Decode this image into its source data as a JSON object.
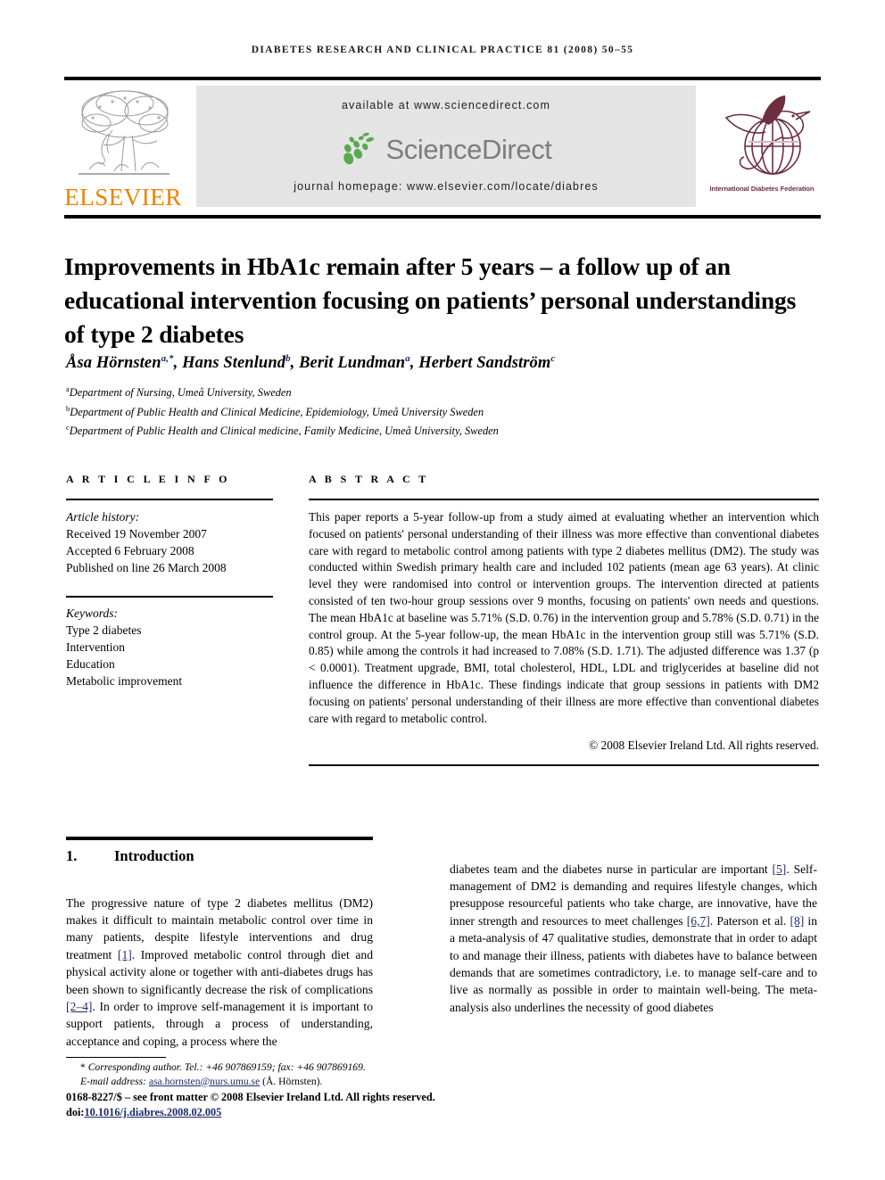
{
  "running_head": "DIABETES RESEARCH AND CLINICAL PRACTICE 81 (2008) 50–55",
  "header": {
    "elsevier_wordmark": "ELSEVIER",
    "elsevier_tree_icon": "elsevier-tree-icon",
    "available_at": "available at www.sciencedirect.com",
    "sciencedirect_wordmark": "ScienceDirect",
    "sciencedirect_leaf_icon": "sciencedirect-leaf-icon",
    "journal_homepage": "journal homepage: www.elsevier.com/locate/diabres",
    "idf_caption": "International Diabetes Federation",
    "idf_bird_globe_icon": "idf-bird-globe-icon",
    "colors": {
      "elsevier_orange": "#F08000",
      "sciencedirect_green": "#5aa84f",
      "sciencedirect_grey": "#7d7d7d",
      "band_grey": "#e4e4e4",
      "idf_maroon": "#6d2f3f"
    }
  },
  "article": {
    "title": "Improvements in HbA1c remain after 5 years – a follow up of an educational intervention focusing on patients’ personal understandings of type 2 diabetes",
    "authors_html": "Åsa Hörnsten<sup>a,*</sup>, Hans Stenlund<sup>b</sup>, Berit Lundman<sup>a</sup>, Herbert Sandström<sup>c</sup>",
    "affiliations": [
      {
        "marker": "a",
        "text": "Department of Nursing, Umeå University, Sweden"
      },
      {
        "marker": "b",
        "text": "Department of Public Health and Clinical Medicine, Epidemiology, Umeå University Sweden"
      },
      {
        "marker": "c",
        "text": "Department of Public Health and Clinical medicine, Family Medicine, Umeå University, Sweden"
      }
    ]
  },
  "article_info": {
    "heading": "A R T I C L E   I N F O",
    "history_label": "Article history:",
    "history": [
      "Received 19 November 2007",
      "Accepted 6 February 2008",
      "Published on line 26 March 2008"
    ],
    "keywords_label": "Keywords:",
    "keywords": [
      "Type 2 diabetes",
      "Intervention",
      "Education",
      "Metabolic improvement"
    ]
  },
  "abstract": {
    "heading": "A B S T R A C T",
    "text": "This paper reports a 5-year follow-up from a study aimed at evaluating whether an intervention which focused on patients' personal understanding of their illness was more effective than conventional diabetes care with regard to metabolic control among patients with type 2 diabetes mellitus (DM2). The study was conducted within Swedish primary health care and included 102 patients (mean age 63 years). At clinic level they were randomised into control or intervention groups. The intervention directed at patients consisted of ten two-hour group sessions over 9 months, focusing on patients' own needs and questions. The mean HbA1c at baseline was 5.71% (S.D. 0.76) in the intervention group and 5.78% (S.D. 0.71) in the control group. At the 5-year follow-up, the mean HbA1c in the intervention group still was 5.71% (S.D. 0.85) while among the controls it had increased to 7.08% (S.D. 1.71). The adjusted difference was 1.37 (p < 0.0001). Treatment upgrade, BMI, total cholesterol, HDL, LDL and triglycerides at baseline did not influence the difference in HbA1c. These findings indicate that group sessions in patients with DM2 focusing on patients' personal understanding of their illness are more effective than conventional diabetes care with regard to metabolic control.",
    "copyright": "© 2008 Elsevier Ireland Ltd. All rights reserved."
  },
  "body": {
    "section_number": "1.",
    "section_title": "Introduction",
    "left_column_paragraph_parts": [
      "The progressive nature of type 2 diabetes mellitus (DM2) makes it difficult to maintain metabolic control over time in many patients, despite lifestyle interventions and drug treatment ",
      "[1]",
      ". Improved metabolic control through diet and physical activity alone or together with anti-diabetes drugs has been shown to significantly decrease the risk of complications ",
      "[2–4]",
      ". In order to improve self-management it is important to support patients, through a process of understanding, acceptance and coping, a process where the"
    ],
    "right_column_paragraph_parts": [
      "diabetes team and the diabetes nurse in particular are important ",
      "[5]",
      ". Self-management of DM2 is demanding and requires lifestyle changes, which presuppose resourceful patients who take charge, are innovative, have the inner strength and resources to meet challenges ",
      "[6,7]",
      ". Paterson et al. ",
      "[8]",
      " in a meta-analysis of 47 qualitative studies, demonstrate that in order to adapt to and manage their illness, patients with diabetes have to balance between demands that are sometimes contradictory, i.e. to manage self-care and to live as normally as possible in order to maintain well-being. The meta-analysis also underlines the necessity of good diabetes"
    ]
  },
  "footer": {
    "corresponding_marker": "*",
    "corresponding_text": "Corresponding author. Tel.: +46 907869159; fax: +46 907869169.",
    "email_label": "E-mail address:",
    "email": "asa.hornsten@nurs.umu.se",
    "email_owner": "(Å. Hörnsten).",
    "issn_line_pre": "0168-8227/$ – see front matter © 2008 Elsevier Ireland Ltd. All rights reserved.",
    "doi_label": "doi:",
    "doi": "10.1016/j.diabres.2008.02.005"
  }
}
